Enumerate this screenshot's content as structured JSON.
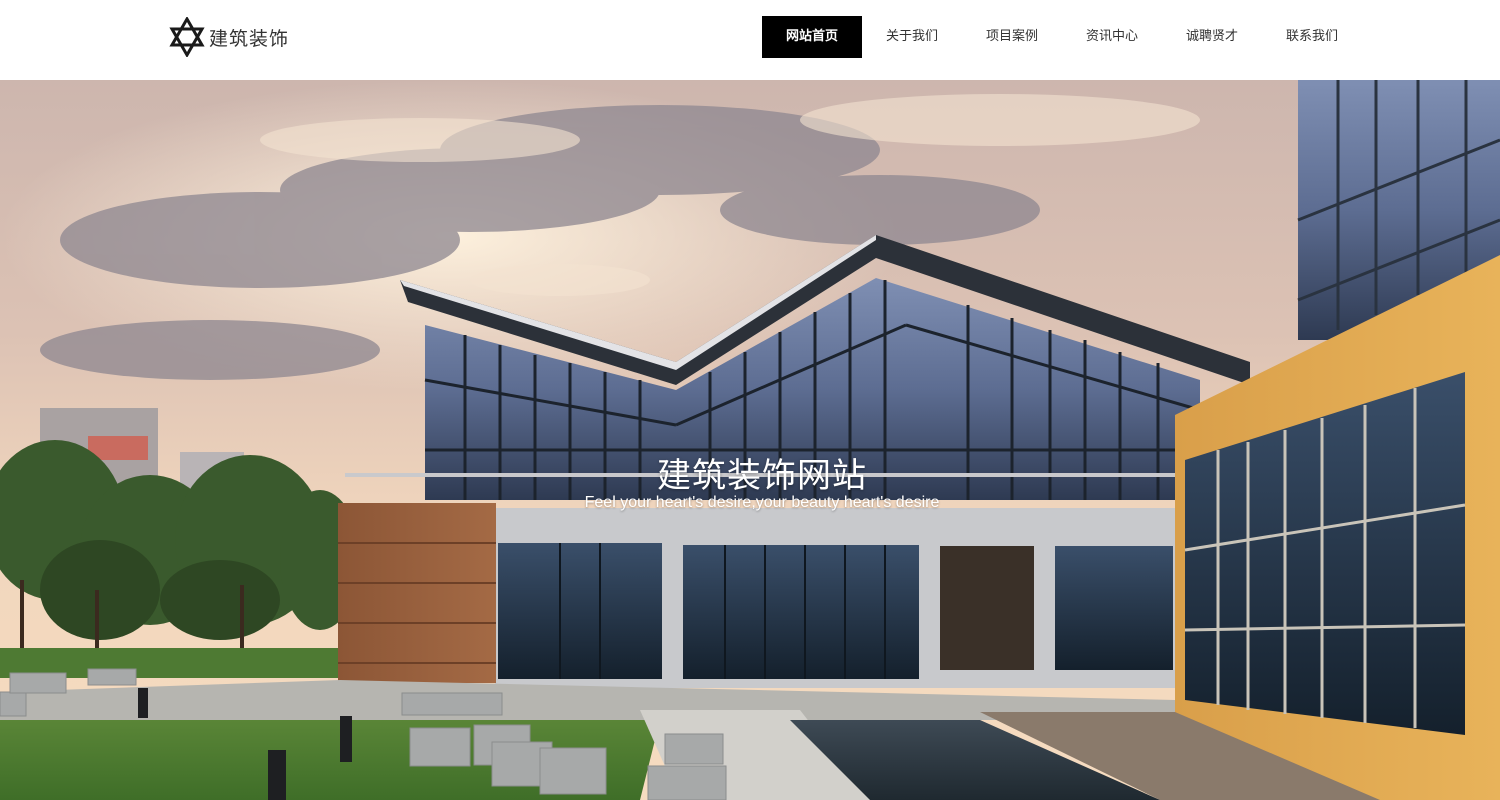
{
  "site": {
    "logo_icon": "star-of-david-icon",
    "logo_text": "建筑装饰"
  },
  "nav": {
    "items": [
      {
        "label": "网站首页",
        "active": true
      },
      {
        "label": "关于我们"
      },
      {
        "label": "项目案例"
      },
      {
        "label": "资讯中心"
      },
      {
        "label": "诚聘贤才"
      },
      {
        "label": "联系我们"
      }
    ],
    "active_bg": "#000000",
    "active_color": "#ffffff"
  },
  "hero": {
    "title": "建筑装饰网站",
    "subtitle": "Feel your heart's desire,your beauty heart's desire"
  }
}
